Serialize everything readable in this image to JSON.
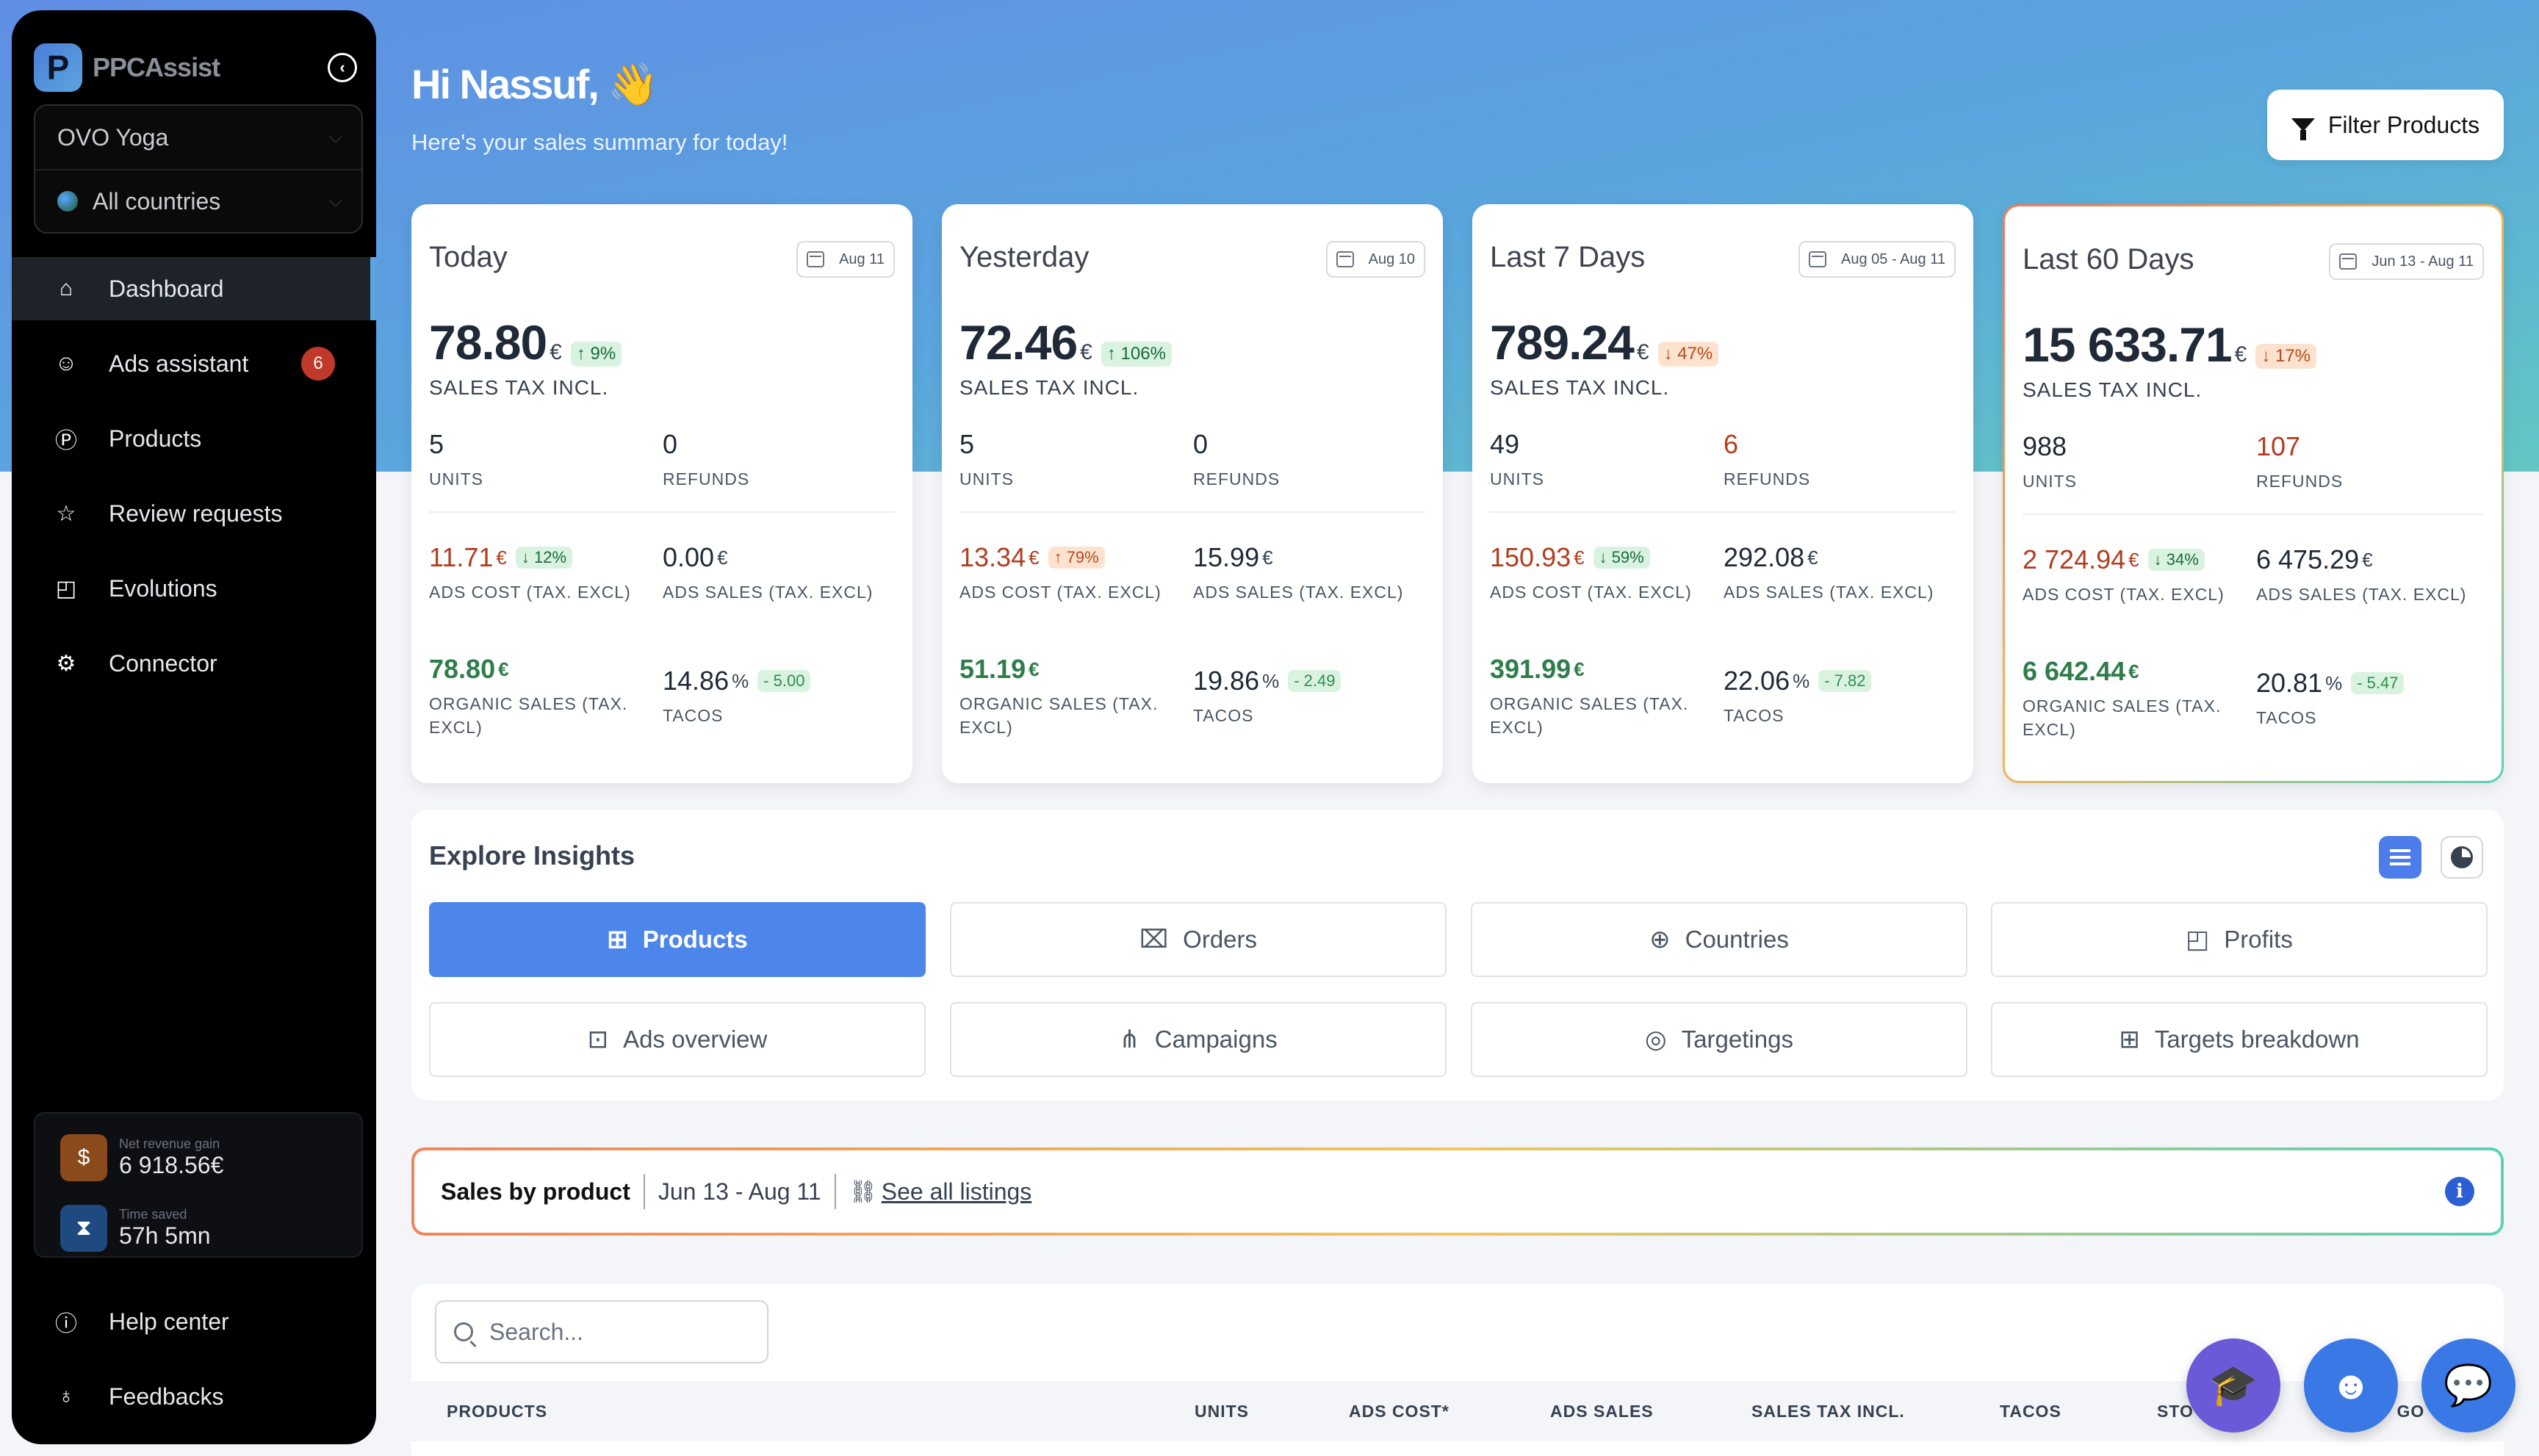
{
  "app": {
    "logo_letter": "P",
    "logo_text": "PPCAssist"
  },
  "sidebar": {
    "store_select": "OVO Yoga",
    "country_select": "All countries",
    "nav": [
      {
        "label": "Dashboard",
        "icon": "home-icon",
        "active": true
      },
      {
        "label": "Ads assistant",
        "icon": "bot-icon",
        "badge": "6"
      },
      {
        "label": "Products",
        "icon": "product-icon"
      },
      {
        "label": "Review requests",
        "icon": "star-icon"
      },
      {
        "label": "Evolutions",
        "icon": "chart-icon"
      },
      {
        "label": "Connector",
        "icon": "plug-icon"
      }
    ],
    "stats": {
      "revenue_label": "Net revenue gain",
      "revenue_value": "6 918.56€",
      "time_label": "Time saved",
      "time_value": "57h 5mn"
    },
    "bottom_nav": [
      {
        "label": "Help center",
        "icon": "help-icon"
      },
      {
        "label": "Feedbacks",
        "icon": "bulb-icon"
      }
    ]
  },
  "header": {
    "greeting": "Hi Nassuf, 👋",
    "subtitle": "Here's your sales summary for today!",
    "filter_button": "Filter Products"
  },
  "cards": [
    {
      "title": "Today",
      "date": "Aug 11",
      "sales": "78.80",
      "sales_change": "↑ 9%",
      "sales_change_dir": "up",
      "sales_label": "SALES TAX INCL.",
      "units": "5",
      "units_label": "UNITS",
      "refunds": "0",
      "refunds_label": "REFUNDS",
      "ads_cost": "11.71",
      "ads_cost_change": "↓ 12%",
      "ads_cost_label": "ADS COST (TAX. EXCL)",
      "ads_sales": "0.00",
      "ads_sales_label": "ADS SALES (TAX. EXCL)",
      "organic": "78.80",
      "organic_label": "ORGANIC SALES (TAX. EXCL)",
      "tacos": "14.86",
      "tacos_change": "- 5.00",
      "tacos_label": "TACOS"
    },
    {
      "title": "Yesterday",
      "date": "Aug 10",
      "sales": "72.46",
      "sales_change": "↑ 106%",
      "sales_change_dir": "up",
      "sales_label": "SALES TAX INCL.",
      "units": "5",
      "units_label": "UNITS",
      "refunds": "0",
      "refunds_label": "REFUNDS",
      "ads_cost": "13.34",
      "ads_cost_change": "↑ 79%",
      "ads_cost_label": "ADS COST (TAX. EXCL)",
      "ads_sales": "15.99",
      "ads_sales_label": "ADS SALES (TAX. EXCL)",
      "organic": "51.19",
      "organic_label": "ORGANIC SALES (TAX. EXCL)",
      "tacos": "19.86",
      "tacos_change": "- 2.49",
      "tacos_label": "TACOS"
    },
    {
      "title": "Last 7 Days",
      "date": "Aug 05 - Aug 11",
      "sales": "789.24",
      "sales_change": "↓ 47%",
      "sales_change_dir": "down",
      "sales_label": "SALES TAX INCL.",
      "units": "49",
      "units_label": "UNITS",
      "refunds": "6",
      "refunds_label": "REFUNDS",
      "ads_cost": "150.93",
      "ads_cost_change": "↓ 59%",
      "ads_cost_label": "ADS COST (TAX. EXCL)",
      "ads_sales": "292.08",
      "ads_sales_label": "ADS SALES (TAX. EXCL)",
      "organic": "391.99",
      "organic_label": "ORGANIC SALES (TAX. EXCL)",
      "tacos": "22.06",
      "tacos_change": "- 7.82",
      "tacos_label": "TACOS"
    },
    {
      "title": "Last 60 Days",
      "date": "Jun 13 - Aug 11",
      "sales": "15 633.71",
      "sales_change": "↓ 17%",
      "sales_change_dir": "down",
      "sales_label": "SALES TAX INCL.",
      "units": "988",
      "units_label": "UNITS",
      "refunds": "107",
      "refunds_label": "REFUNDS",
      "ads_cost": "2 724.94",
      "ads_cost_change": "↓ 34%",
      "ads_cost_label": "ADS COST (TAX. EXCL)",
      "ads_sales": "6 475.29",
      "ads_sales_label": "ADS SALES (TAX. EXCL)",
      "organic": "6 642.44",
      "organic_label": "ORGANIC SALES (TAX. EXCL)",
      "tacos": "20.81",
      "tacos_change": "- 5.47",
      "tacos_label": "TACOS"
    }
  ],
  "currency": "€",
  "percent": "%",
  "insights": {
    "title": "Explore Insights",
    "buttons": [
      {
        "label": "Products",
        "icon": "product-icon",
        "active": true
      },
      {
        "label": "Orders",
        "icon": "bag-icon"
      },
      {
        "label": "Countries",
        "icon": "globe-icon"
      },
      {
        "label": "Profits",
        "icon": "chart-icon"
      },
      {
        "label": "Ads overview",
        "icon": "presentation-icon"
      },
      {
        "label": "Campaigns",
        "icon": "hierarchy-icon"
      },
      {
        "label": "Targetings",
        "icon": "target-icon"
      },
      {
        "label": "Targets breakdown",
        "icon": "grid-icon"
      }
    ]
  },
  "sales_by_product": {
    "title": "Sales by product",
    "range": "Jun 13 - Aug 11",
    "link": "See all listings"
  },
  "table": {
    "search_placeholder": "Search...",
    "columns": [
      "PRODUCTS",
      "UNITS",
      "ADS COST*",
      "ADS SALES",
      "SALES TAX INCL.",
      "TACOS",
      "STO",
      "F GO"
    ]
  },
  "colors": {
    "accent": "#4d86ea",
    "sidebar": "#000000",
    "negative": "#b23c1e",
    "positive": "#2f7d4a"
  }
}
